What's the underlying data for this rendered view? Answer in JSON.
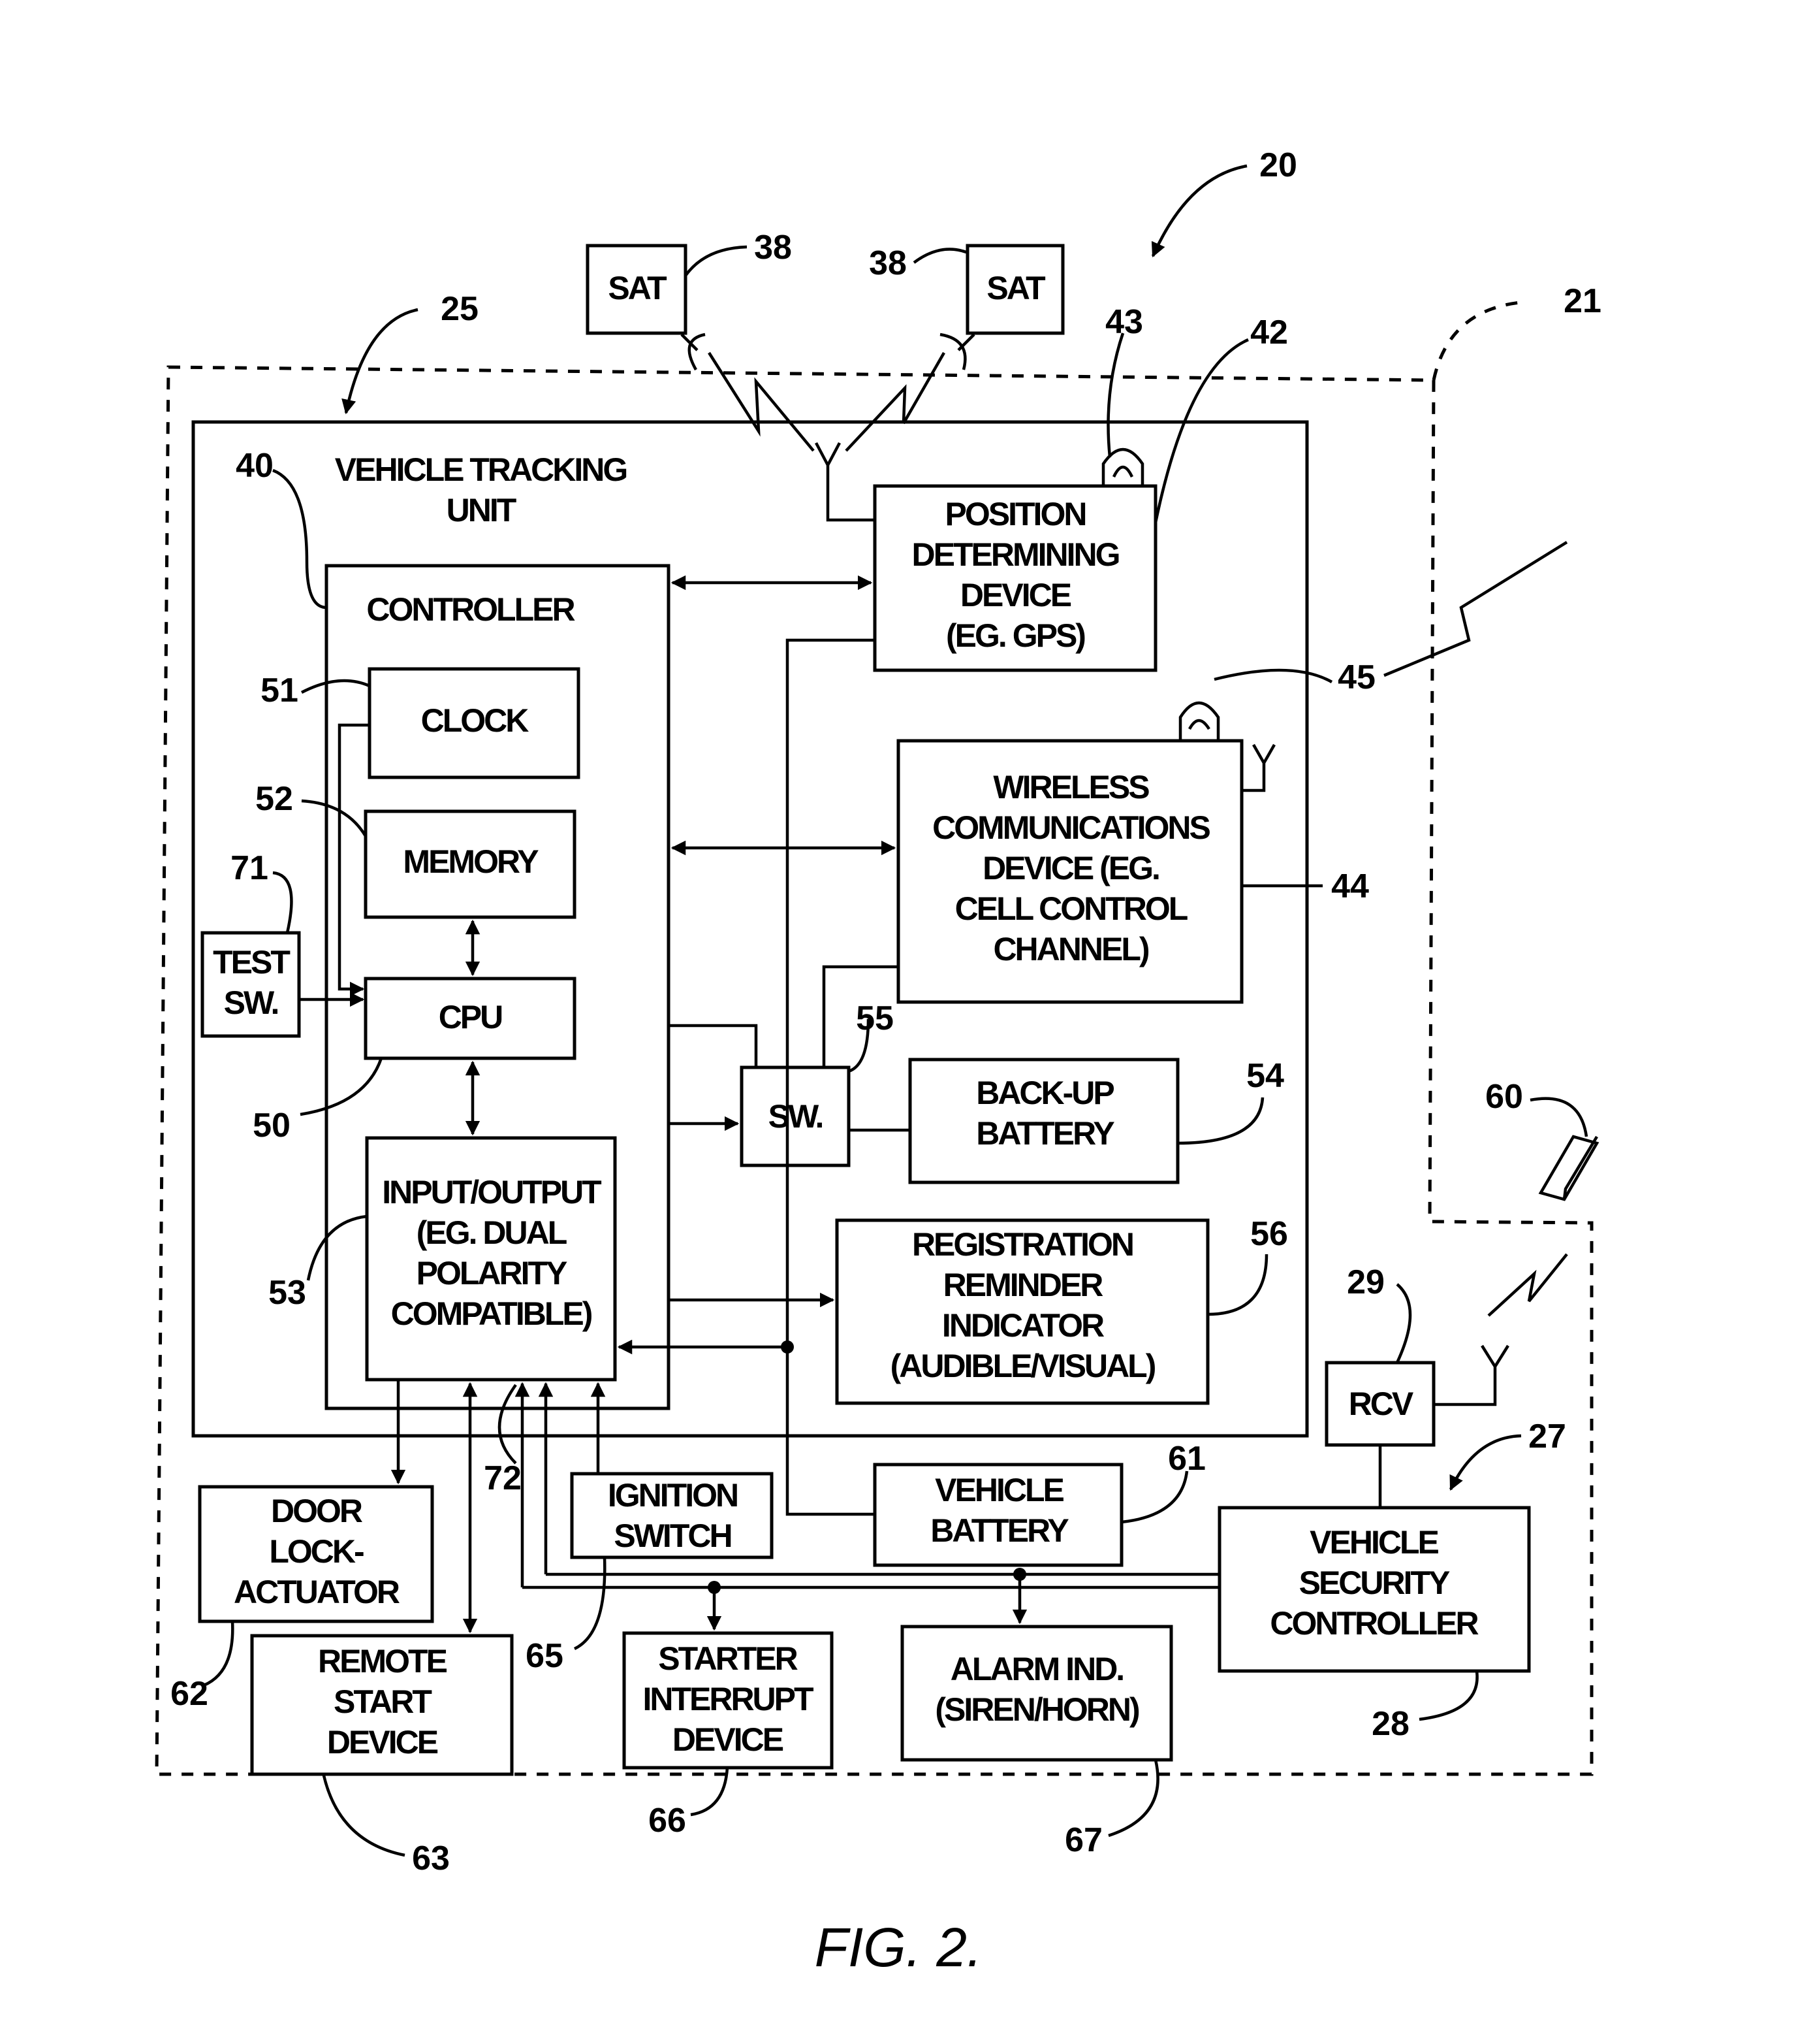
{
  "figure": {
    "caption": "FIG. 2.",
    "ref_numerals": {
      "system": "20",
      "vehicle_boundary": "21",
      "tracking_unit": "25",
      "security_system": "27",
      "security_controller": "28",
      "receiver": "29",
      "satellite": "38",
      "controller": "40",
      "position_device": "42",
      "position_antenna": "43",
      "wireless_device": "44",
      "wireless_antenna": "45",
      "cpu": "50",
      "clock": "51",
      "memory": "52",
      "io": "53",
      "backup_battery": "54",
      "switch": "55",
      "registration_indicator": "56",
      "remote_transmitter": "60",
      "vehicle_battery": "61",
      "door_lock": "62",
      "remote_start": "63",
      "ignition": "65",
      "starter_interrupt": "66",
      "alarm": "67",
      "test_switch": "71",
      "io_lines": "72"
    },
    "blocks": {
      "sat_left": [
        "SAT"
      ],
      "sat_right": [
        "SAT"
      ],
      "tracking_unit_title": [
        "VEHICLE TRACKING",
        "UNIT"
      ],
      "controller_title": [
        "CONTROLLER"
      ],
      "clock": [
        "CLOCK"
      ],
      "memory": [
        "MEMORY"
      ],
      "cpu": [
        "CPU"
      ],
      "io": [
        "INPUT/OUTPUT",
        "(EG. DUAL",
        "POLARITY",
        "COMPATIBLE)"
      ],
      "test_switch": [
        "TEST",
        "SW."
      ],
      "position_device": [
        "POSITION",
        "DETERMINING",
        "DEVICE",
        "(EG. GPS)"
      ],
      "wireless_device": [
        "WIRELESS",
        "COMMUNICATIONS",
        "DEVICE (EG.",
        "CELL CONTROL",
        "CHANNEL)"
      ],
      "switch": [
        "SW."
      ],
      "backup_battery": [
        "BACK-UP",
        "BATTERY"
      ],
      "registration_indicator": [
        "REGISTRATION",
        "REMINDER",
        "INDICATOR",
        "(AUDIBLE/VISUAL)"
      ],
      "door_lock": [
        "DOOR",
        "LOCK-",
        "ACTUATOR"
      ],
      "remote_start": [
        "REMOTE",
        "START",
        "DEVICE"
      ],
      "ignition": [
        "IGNITION",
        "SWITCH"
      ],
      "vehicle_battery": [
        "VEHICLE",
        "BATTERY"
      ],
      "starter_interrupt": [
        "STARTER",
        "INTERRUPT",
        "DEVICE"
      ],
      "alarm": [
        "ALARM IND.",
        "(SIREN/HORN)"
      ],
      "receiver": [
        "RCV"
      ],
      "security_controller": [
        "VEHICLE",
        "SECURITY",
        "CONTROLLER"
      ]
    }
  }
}
